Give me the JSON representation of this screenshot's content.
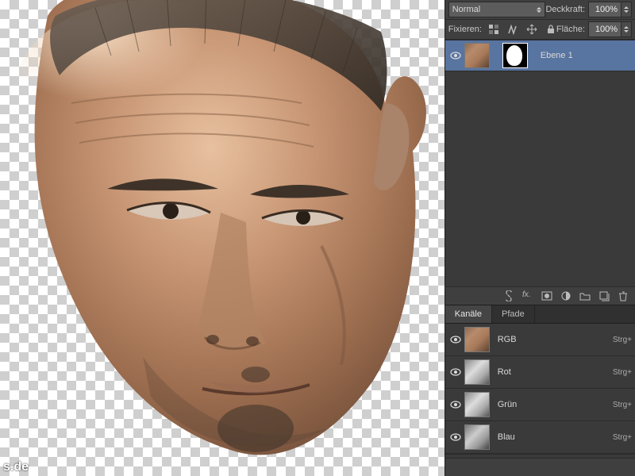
{
  "watermark": "s.de",
  "layers_panel": {
    "blend_mode": "Normal",
    "opacity_label": "Deckkraft:",
    "opacity_value": "100%",
    "fill_label": "Fläche:",
    "fill_value": "100%",
    "lock_label": "Fixieren:",
    "layer": {
      "name": "Ebene 1"
    },
    "footer_icons": [
      "link",
      "fx",
      "mask",
      "adjust",
      "group",
      "new",
      "trash"
    ]
  },
  "channels_panel": {
    "tabs": {
      "channels": "Kanäle",
      "paths": "Pfade"
    },
    "items": [
      {
        "name": "RGB",
        "shortcut": "Strg+"
      },
      {
        "name": "Rot",
        "shortcut": "Strg+"
      },
      {
        "name": "Grün",
        "shortcut": "Strg+"
      },
      {
        "name": "Blau",
        "shortcut": "Strg+"
      }
    ]
  }
}
